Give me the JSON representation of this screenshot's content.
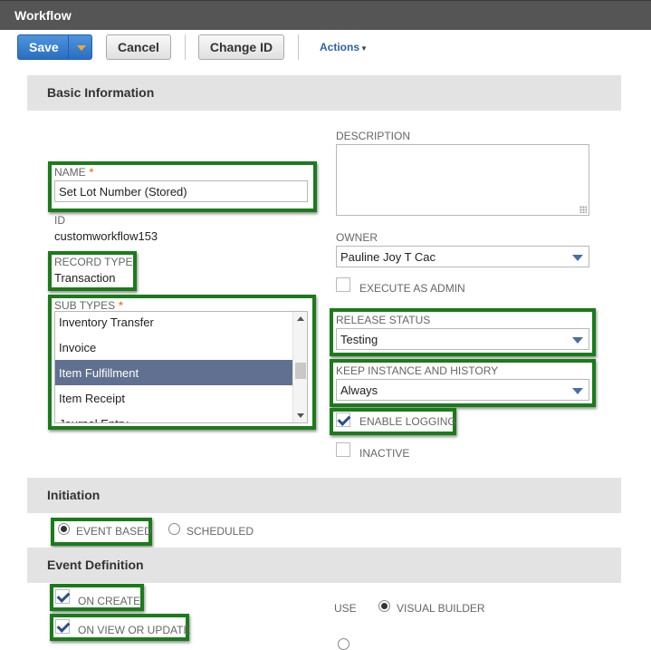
{
  "window": {
    "title": "Workflow"
  },
  "toolbar": {
    "save_label": "Save",
    "cancel_label": "Cancel",
    "change_id_label": "Change ID",
    "actions_label": "Actions"
  },
  "basic_info": {
    "heading": "Basic Information",
    "name_label": "NAME",
    "name_value": "Set Lot Number (Stored)",
    "id_label": "ID",
    "id_value": "customworkflow153",
    "record_type_label": "RECORD TYPE",
    "record_type_value": "Transaction",
    "sub_types_label": "SUB TYPES",
    "sub_types": [
      "Inventory Transfer",
      "Invoice",
      "Item Fulfillment",
      "Item Receipt",
      "Journal Entry"
    ],
    "sub_types_selected": "Item Fulfillment",
    "description_label": "DESCRIPTION",
    "description_value": "",
    "owner_label": "OWNER",
    "owner_value": "Pauline Joy T Cac",
    "execute_as_admin_label": "EXECUTE AS ADMIN",
    "execute_as_admin_checked": false,
    "release_status_label": "RELEASE STATUS",
    "release_status_value": "Testing",
    "keep_instance_label": "KEEP INSTANCE AND HISTORY",
    "keep_instance_value": "Always",
    "enable_logging_label": "ENABLE LOGGING",
    "enable_logging_checked": true,
    "inactive_label": "INACTIVE",
    "inactive_checked": false,
    "required_marker": "*"
  },
  "initiation": {
    "heading": "Initiation",
    "event_based_label": "EVENT BASED",
    "scheduled_label": "SCHEDULED",
    "selected": "EVENT BASED"
  },
  "event_definition": {
    "heading": "Event Definition",
    "on_create_label": "ON CREATE",
    "on_create_checked": true,
    "on_view_update_label": "ON VIEW OR UPDATE",
    "on_view_update_checked": true,
    "use_label": "USE",
    "visual_builder_label": "VISUAL BUILDER"
  },
  "colors": {
    "title_bar": "#555555",
    "save_button": "#2a6ec2",
    "highlight_border": "#1b7b1b",
    "selected_row": "#607090",
    "required_asterisk": "#e8862a",
    "link": "#2d62a8"
  }
}
